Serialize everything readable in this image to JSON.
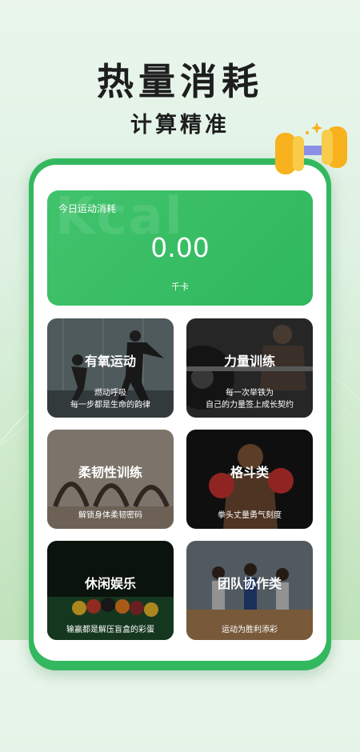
{
  "hero": {
    "title": "热量消耗",
    "subtitle": "计算精准"
  },
  "kcal_card": {
    "label": "今日运动消耗",
    "watermark": "Kcal",
    "value": "0.00",
    "unit": "千卡"
  },
  "categories": [
    {
      "title": "有氧运动",
      "desc": [
        "燃动呼吸",
        "每一步都是生命的韵律"
      ]
    },
    {
      "title": "力量训练",
      "desc": [
        "每一次举铁为",
        "自己的力量签上成长契约"
      ]
    },
    {
      "title": "柔韧性训练",
      "desc": [
        "解锁身体柔韧密码",
        ""
      ]
    },
    {
      "title": "格斗类",
      "desc": [
        "拳头丈量勇气刻度",
        ""
      ]
    },
    {
      "title": "休闲娱乐",
      "desc": [
        "输赢都是解压盲盒的彩蛋",
        ""
      ]
    },
    {
      "title": "团队协作类",
      "desc": [
        "运动为胜利添彩",
        ""
      ]
    }
  ],
  "colors": {
    "brand_green": "#33b85f",
    "card_green": "#41c36c"
  }
}
